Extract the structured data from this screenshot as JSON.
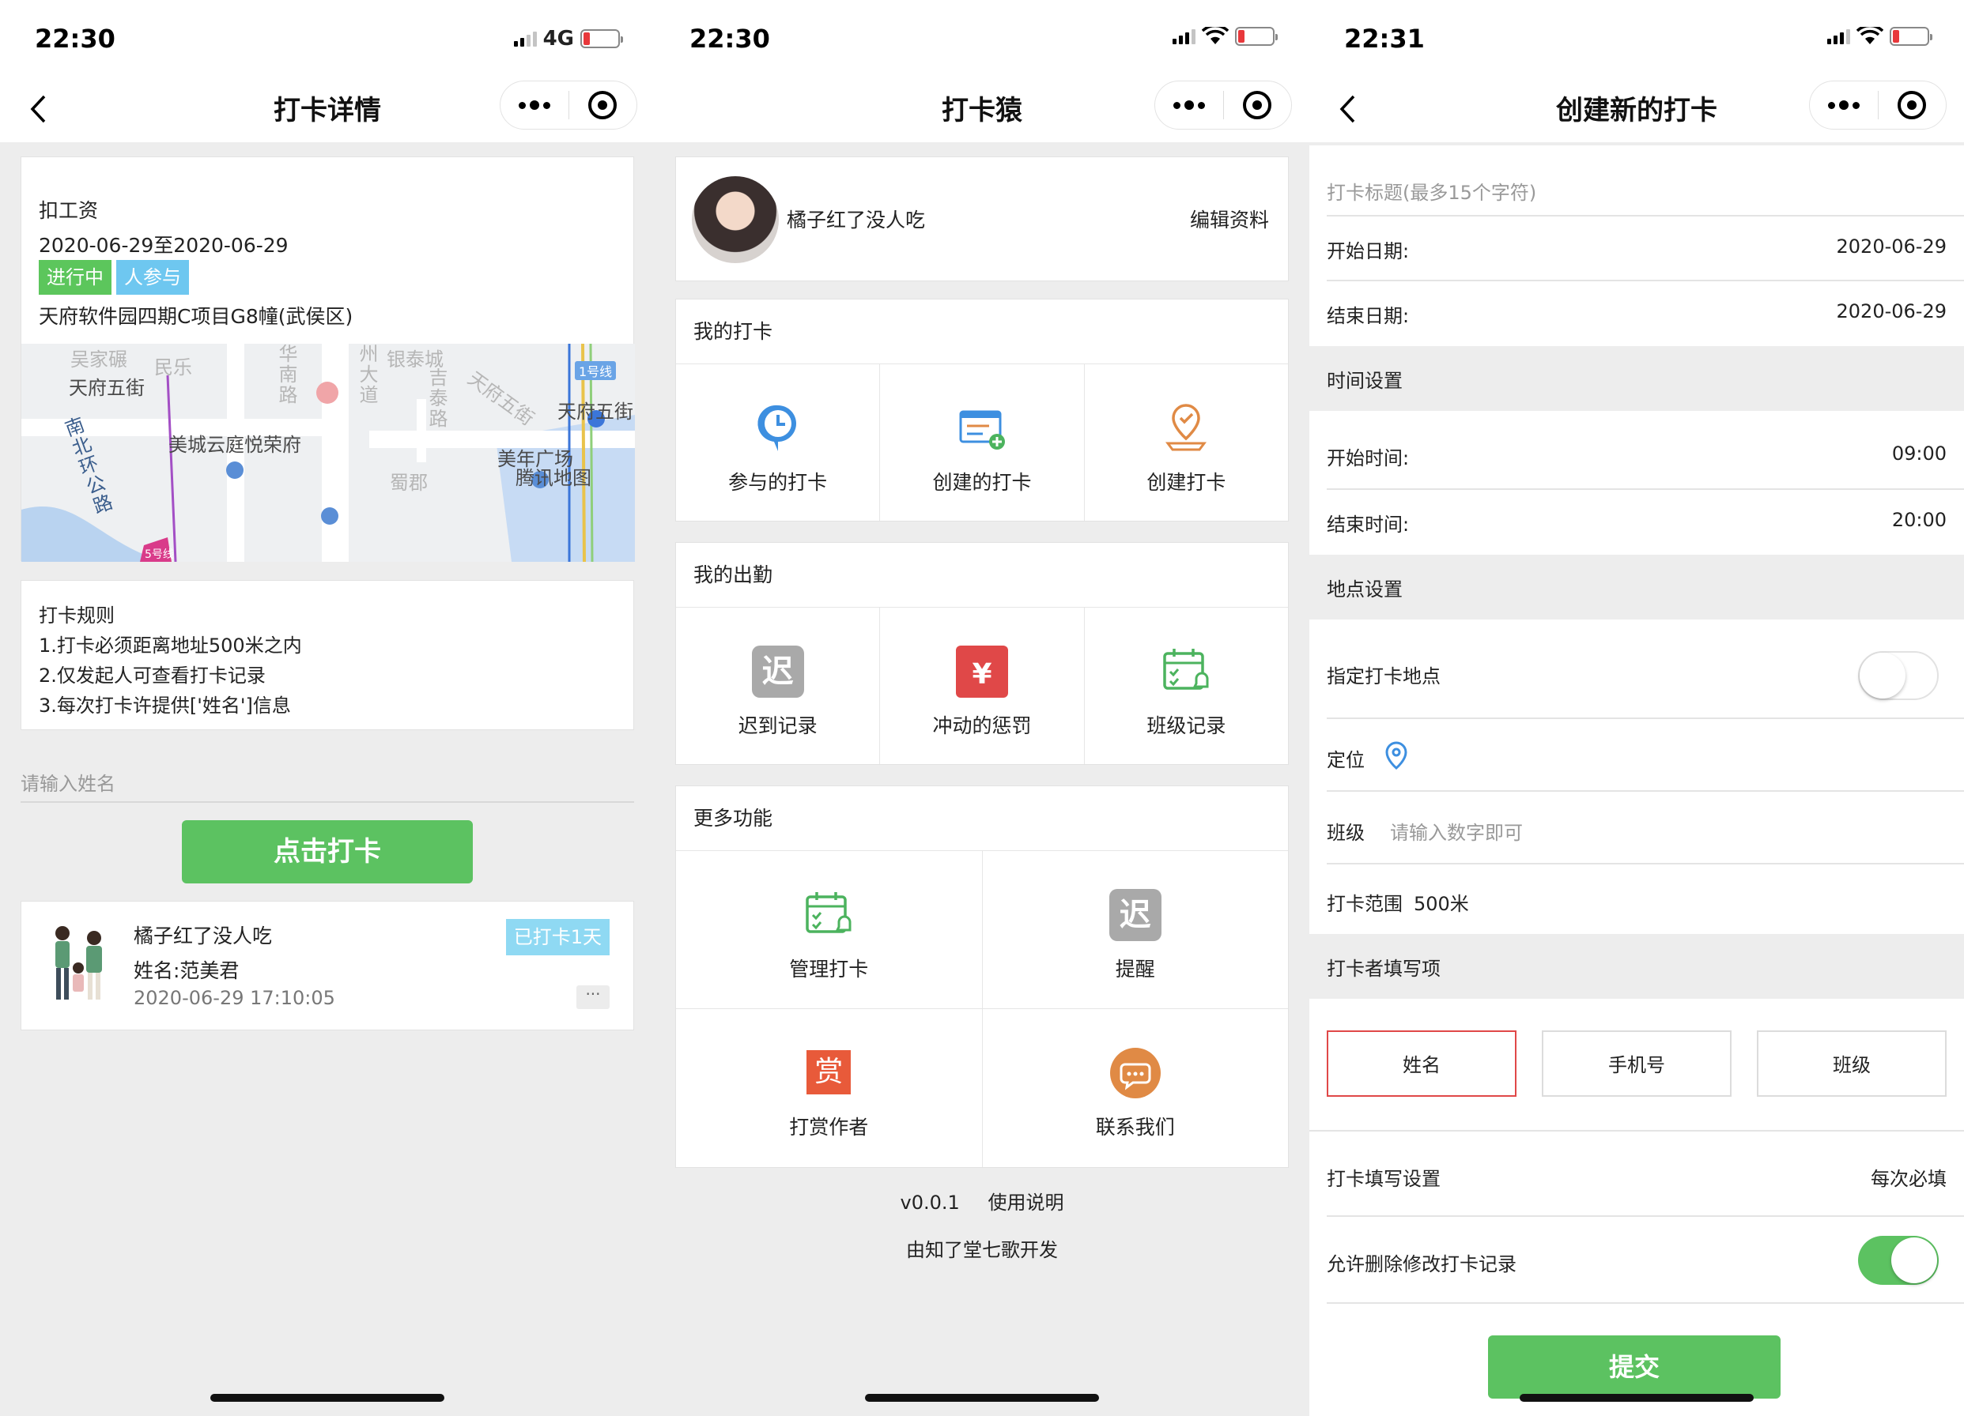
{
  "status": {
    "s1": {
      "time": "22:30",
      "network": "4G"
    },
    "s2": {
      "time": "22:30"
    },
    "s3": {
      "time": "22:31"
    }
  },
  "screen1": {
    "title": "打卡详情",
    "event_name": "扣工资",
    "date_range": "2020-06-29至2020-06-29",
    "tag_status": "进行中",
    "tag_people": "人参与",
    "address": "天府软件园四期C项目G8幢(武侯区)",
    "map": {
      "labels": [
        "吴家碾",
        "民乐",
        "天府五街",
        "华南路",
        "州大道",
        "银泰城",
        "吉泰路",
        "天府五街",
        "1号线",
        "天府五街",
        "南北环公路",
        "美城云庭悦荣府",
        "美年广场",
        "腾讯地图",
        "蜀郡",
        "5号线"
      ]
    },
    "rules_title": "打卡规则",
    "rules": [
      "1.打卡必须距离地址500米之内",
      "2.仅发起人可查看打卡记录",
      "3.每次打卡许提供['姓名']信息"
    ],
    "name_placeholder": "请输入姓名",
    "checkin_button": "点击打卡",
    "record": {
      "user": "橘子红了没人吃",
      "real_name": "姓名:范美君",
      "time": "2020-06-29 17:10:05",
      "badge": "已打卡1天",
      "more": "···"
    }
  },
  "screen2": {
    "title": "打卡猿",
    "username": "橘子红了没人吃",
    "edit_profile": "编辑资料",
    "my_checkin": {
      "head": "我的打卡",
      "items": [
        "参与的打卡",
        "创建的打卡",
        "创建打卡"
      ]
    },
    "my_attendance": {
      "head": "我的出勤",
      "items": [
        "迟到记录",
        "冲动的惩罚",
        "班级记录"
      ]
    },
    "more": {
      "head": "更多功能",
      "items": [
        "管理打卡",
        "提醒",
        "打赏作者",
        "联系我们"
      ]
    },
    "icon_glyphs": {
      "late": "迟",
      "yen": "¥",
      "reward": "赏"
    },
    "version": "v0.0.1",
    "guide": "使用说明",
    "credit": "由知了堂七歌开发"
  },
  "screen3": {
    "title": "创建新的打卡",
    "title_placeholder": "打卡标题(最多15个字符)",
    "start_date_label": "开始日期:",
    "start_date": "2020-06-29",
    "end_date_label": "结束日期:",
    "end_date": "2020-06-29",
    "time_settings": "时间设置",
    "start_time_label": "开始时间:",
    "start_time": "09:00",
    "end_time_label": "结束时间:",
    "end_time": "20:00",
    "location_settings": "地点设置",
    "specify_location": "指定打卡地点",
    "specify_location_on": false,
    "locate_label": "定位",
    "class_label": "班级",
    "class_placeholder": "请输入数字即可",
    "range_label": "打卡范围",
    "range_value": "500米",
    "fill_items_head": "打卡者填写项",
    "fill_options": [
      "姓名",
      "手机号",
      "班级"
    ],
    "fill_setting_label": "打卡填写设置",
    "fill_setting_value": "每次必填",
    "allow_edit_label": "允许删除修改打卡记录",
    "allow_edit_on": true,
    "submit": "提交"
  },
  "colors": {
    "green": "#5cc261",
    "tag_blue": "#6ec7f0",
    "badge_blue": "#8fd9f3",
    "selected_border": "#e04848",
    "icon_blue": "#3d8fe0",
    "icon_orange": "#e08a45",
    "icon_red": "#e04848",
    "icon_gray": "#a9a9a9"
  }
}
